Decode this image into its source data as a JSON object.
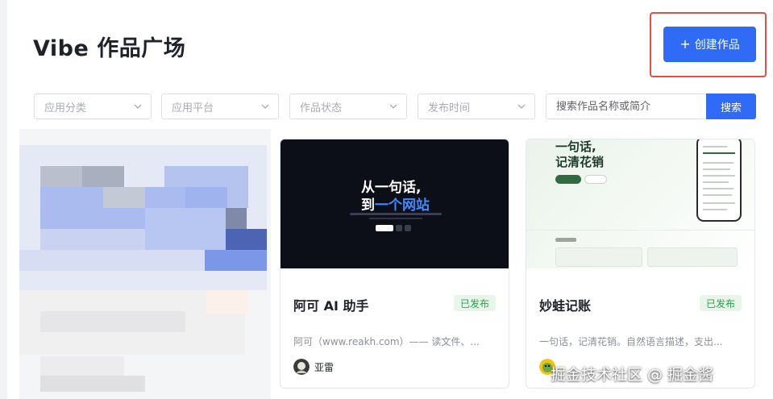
{
  "page": {
    "title": "Vibe 作品广场",
    "create_button": {
      "icon": "plus-icon",
      "label": "创建作品"
    }
  },
  "filters": {
    "app_category": "应用分类",
    "app_platform": "应用平台",
    "work_status": "作品状态",
    "publish_time": "发布时间",
    "search_placeholder": "搜索作品名称或简介",
    "search_button": "搜索"
  },
  "cards": [
    {
      "thumbnail": {
        "hero_line1": "从一句话,",
        "hero_line2_prefix": "到",
        "hero_line2_accent": "一个网站"
      },
      "title": "阿可 AI 助手",
      "status": "已发布",
      "description": "阿可（www.reakh.com）—— 读文件、...",
      "author": "亚雷"
    },
    {
      "thumbnail": {
        "hero_line1": "一句话,",
        "hero_line2": "记清花销"
      },
      "title": "妙蛙记账",
      "status": "已发布",
      "description": "一句话，记清花销。自然语言描述，支出...",
      "author": ""
    }
  ],
  "watermark": "掘金技术社区 @ 掘金酱",
  "colors": {
    "primary": "#2f6bf6",
    "highlight_border": "#e2504a",
    "published_badge_bg": "#e7f6e9",
    "published_badge_text": "#2e9f4a"
  }
}
